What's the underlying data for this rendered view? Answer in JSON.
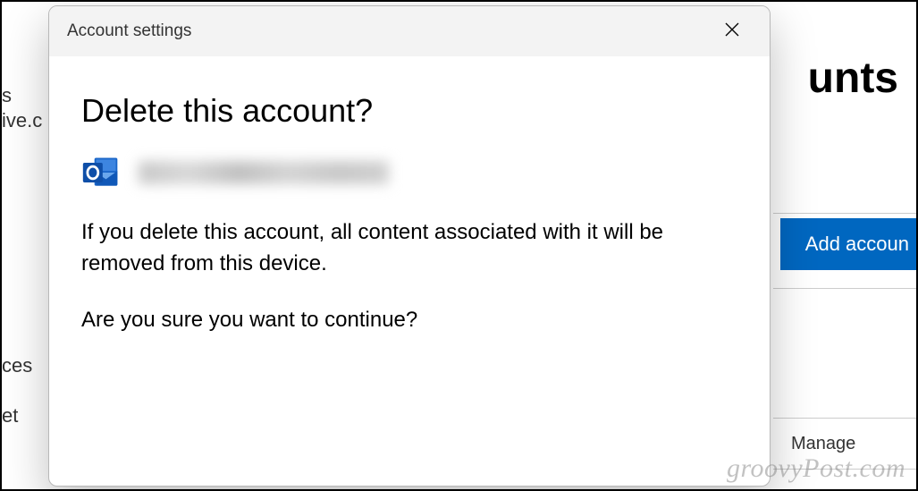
{
  "background": {
    "page_title_fragment": "unts",
    "sidebar_fragments": {
      "s": "s",
      "ive": "ive.c",
      "ces": "ces",
      "et": "et"
    },
    "add_account_label": "Add accoun",
    "manage_label": "Manage"
  },
  "dialog": {
    "header_title": "Account settings",
    "heading": "Delete this account?",
    "warning_text": "If you delete this account, all content associated with it will be removed from this device.",
    "confirm_text": "Are you sure you want to continue?"
  },
  "watermark": "groovyPost.com"
}
